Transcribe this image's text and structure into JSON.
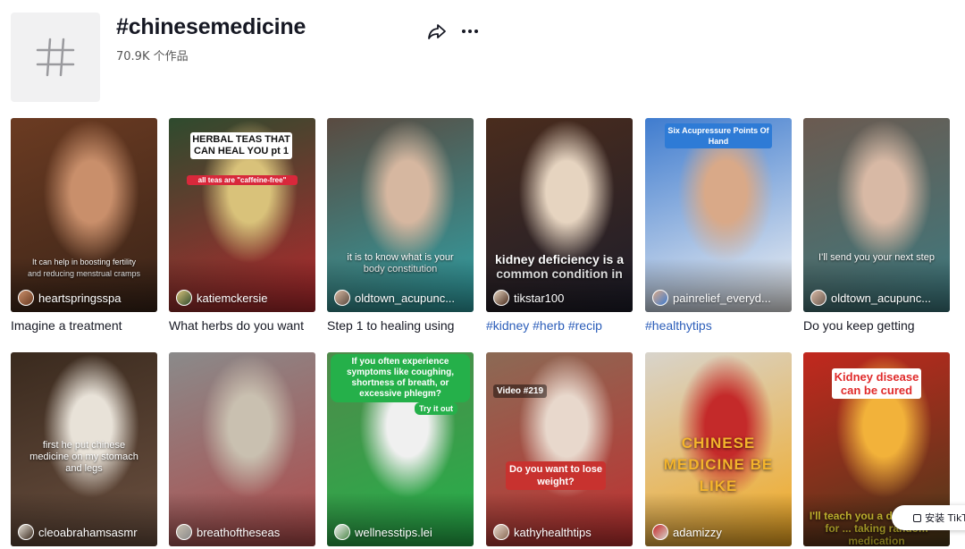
{
  "header": {
    "title": "#chinesemedicine",
    "count": "70.9K 个作品",
    "share_icon": "share-icon",
    "more_icon": "more-icon"
  },
  "videos": [
    {
      "user": "heartspringsspa",
      "desc": "Imagine a treatment",
      "overlay": "It can help in boosting fertility and reducing menstrual cramps",
      "is_tag": false,
      "colors": [
        "#6b3b22",
        "#c98f6b",
        "#3a2418"
      ]
    },
    {
      "user": "katiemckersie",
      "desc": "What herbs do you want",
      "overlay": "HERBAL TEAS THAT CAN HEAL YOU pt 1",
      "overlay2": "all teas are \"caffeine-free\"",
      "is_tag": false,
      "colors": [
        "#2e4b2e",
        "#d9c27a",
        "#b3282d"
      ]
    },
    {
      "user": "oldtown_acupunc...",
      "desc": "Step 1 to healing using",
      "overlay": "it is to know what is your body constitution",
      "is_tag": false,
      "colors": [
        "#5a4a40",
        "#d6b7a0",
        "#2fa2a6"
      ]
    },
    {
      "user": "tikstar100",
      "desc": "#kidney #herb #recip",
      "overlay": "kidney deficiency is a common condition in",
      "is_tag": true,
      "colors": [
        "#4a2c1d",
        "#e6d4c0",
        "#1d1d2a"
      ]
    },
    {
      "user": "painrelief_everyd...",
      "desc": "#healthytips",
      "overlay": "Six Acupressure Points Of Hand",
      "is_tag": true,
      "colors": [
        "#3f7ccf",
        "#d9a988",
        "#f4f4f4"
      ]
    },
    {
      "user": "oldtown_acupunc...",
      "desc": "Do you keep getting",
      "overlay": "I'll send you your next step",
      "is_tag": false,
      "colors": [
        "#6b5a50",
        "#d8b9a5",
        "#3c7a80"
      ]
    },
    {
      "user": "cleoabrahamsasmr",
      "desc": "",
      "overlay": "first he put chinese medicine on my stomach and legs",
      "is_tag": false,
      "colors": [
        "#3a2a1e",
        "#e8e2d8",
        "#6b5040"
      ]
    },
    {
      "user": "breathoftheseas",
      "desc": "",
      "overlay": "",
      "is_tag": false,
      "colors": [
        "#8a8a8a",
        "#c9c0b0",
        "#b04a4a"
      ]
    },
    {
      "user": "wellnesstips.lei",
      "desc": "",
      "overlay": "If you often experience symptoms like coughing, shortness of breath, or excessive phlegm?",
      "overlay2": "Try it out",
      "is_tag": false,
      "colors": [
        "#4f8a4a",
        "#f0f0f0",
        "#25b04a"
      ]
    },
    {
      "user": "kathyhealthtips",
      "desc": "",
      "overlay": "Video #219",
      "overlay2": "Do you want to lose weight?",
      "is_tag": false,
      "colors": [
        "#8b6a55",
        "#e8d8cc",
        "#c03030"
      ]
    },
    {
      "user": "adamizzy",
      "desc": "",
      "overlay": "CHINESE MEDICINE BE LIKE",
      "is_tag": false,
      "colors": [
        "#d8d4cc",
        "#c42a2a",
        "#f2a81e"
      ]
    },
    {
      "user": "",
      "desc": "",
      "overlay": "Kidney disease can be cured",
      "overlay2": "I'll teach you a d... doctors for ... taking random medication",
      "is_tag": false,
      "colors": [
        "#c2281e",
        "#f2b23a",
        "#4a3a1a"
      ]
    }
  ],
  "install": {
    "label": "安装 TikTo"
  }
}
